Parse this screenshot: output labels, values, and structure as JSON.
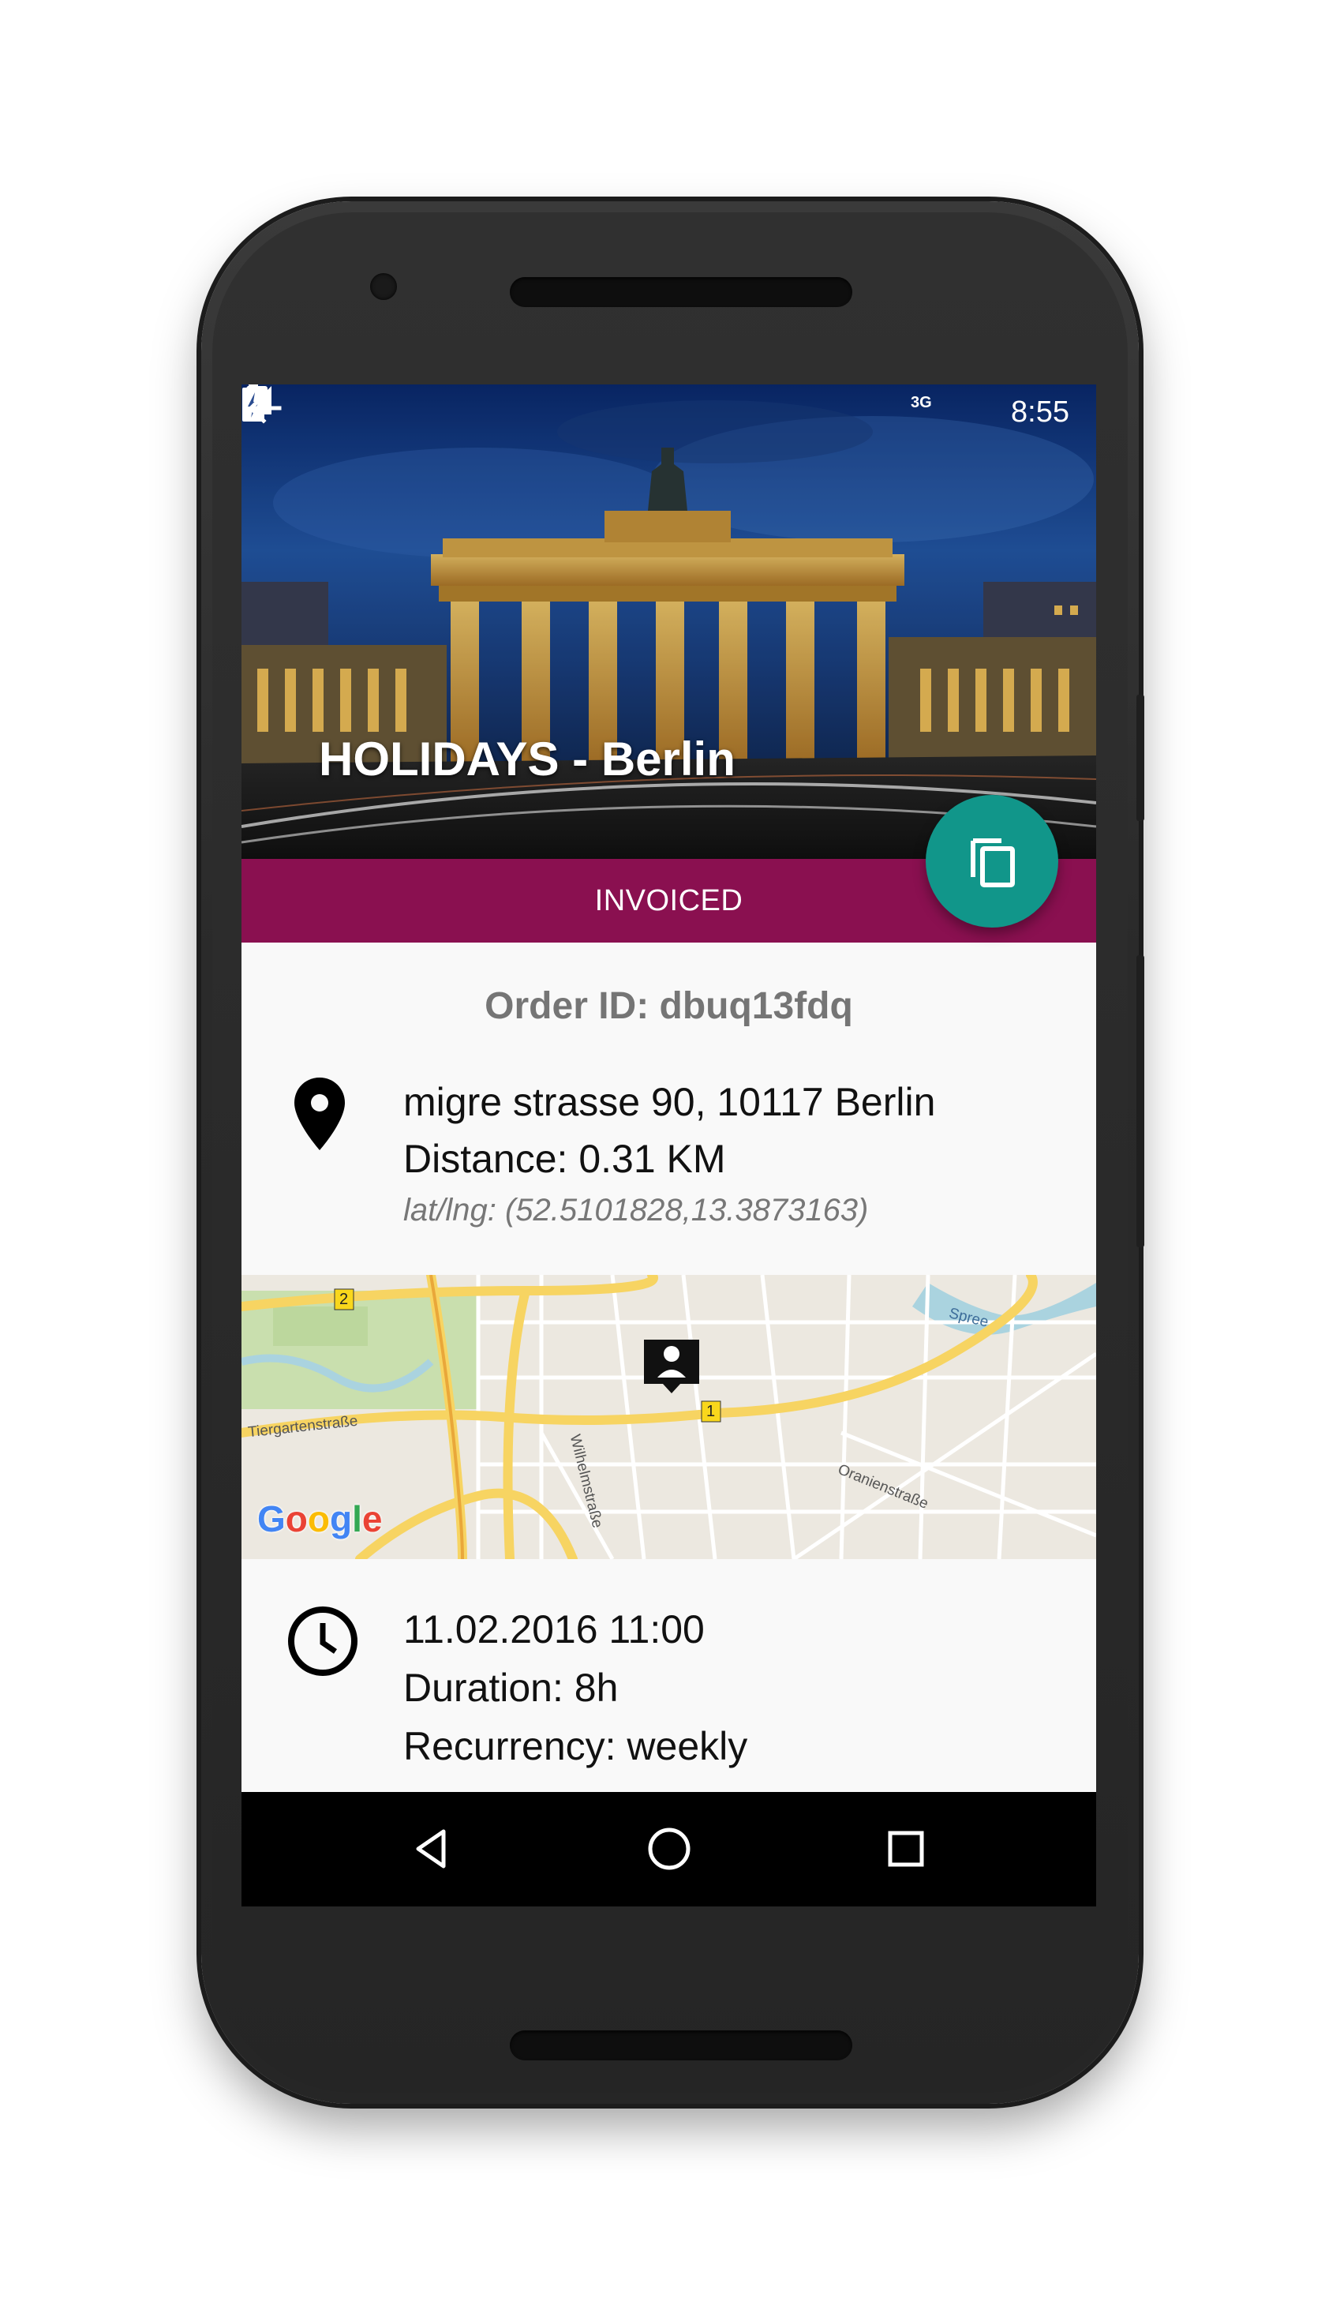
{
  "status_bar": {
    "network": "3G",
    "time": "8:55",
    "icons": [
      "sd-card-icon",
      "signal-icon",
      "battery-charging-icon"
    ]
  },
  "header": {
    "title": "HOLIDAYS - Berlin",
    "back_icon": "arrow-back-icon",
    "image": "brandenburg-gate-night-photo"
  },
  "order_status": {
    "label": "INVOICED",
    "color": "#8a1050"
  },
  "fab": {
    "icon": "copy-icon",
    "color": "#11968a"
  },
  "order": {
    "id_text": "Order ID: dbuq13fdq"
  },
  "location": {
    "icon": "location-pin-icon",
    "address": "migre strasse 90, 10117 Berlin",
    "distance": "Distance: 0.31 KM",
    "latlng": "lat/lng: (52.5101828,13.3873163)"
  },
  "map": {
    "labels": {
      "spree": "Spree",
      "tiergarten": "Tiergartenstraße",
      "wilhelm": "Wilhelmstraße",
      "oranien": "Oranienstraße",
      "route1": "1",
      "route2": "2"
    },
    "logo": "Google"
  },
  "schedule": {
    "icon": "clock-icon",
    "datetime": "11.02.2016 11:00",
    "duration": "Duration: 8h",
    "recurrency": "Recurrency: weekly"
  },
  "navbar": {
    "icons": [
      "nav-back-icon",
      "nav-home-icon",
      "nav-recents-icon"
    ]
  }
}
